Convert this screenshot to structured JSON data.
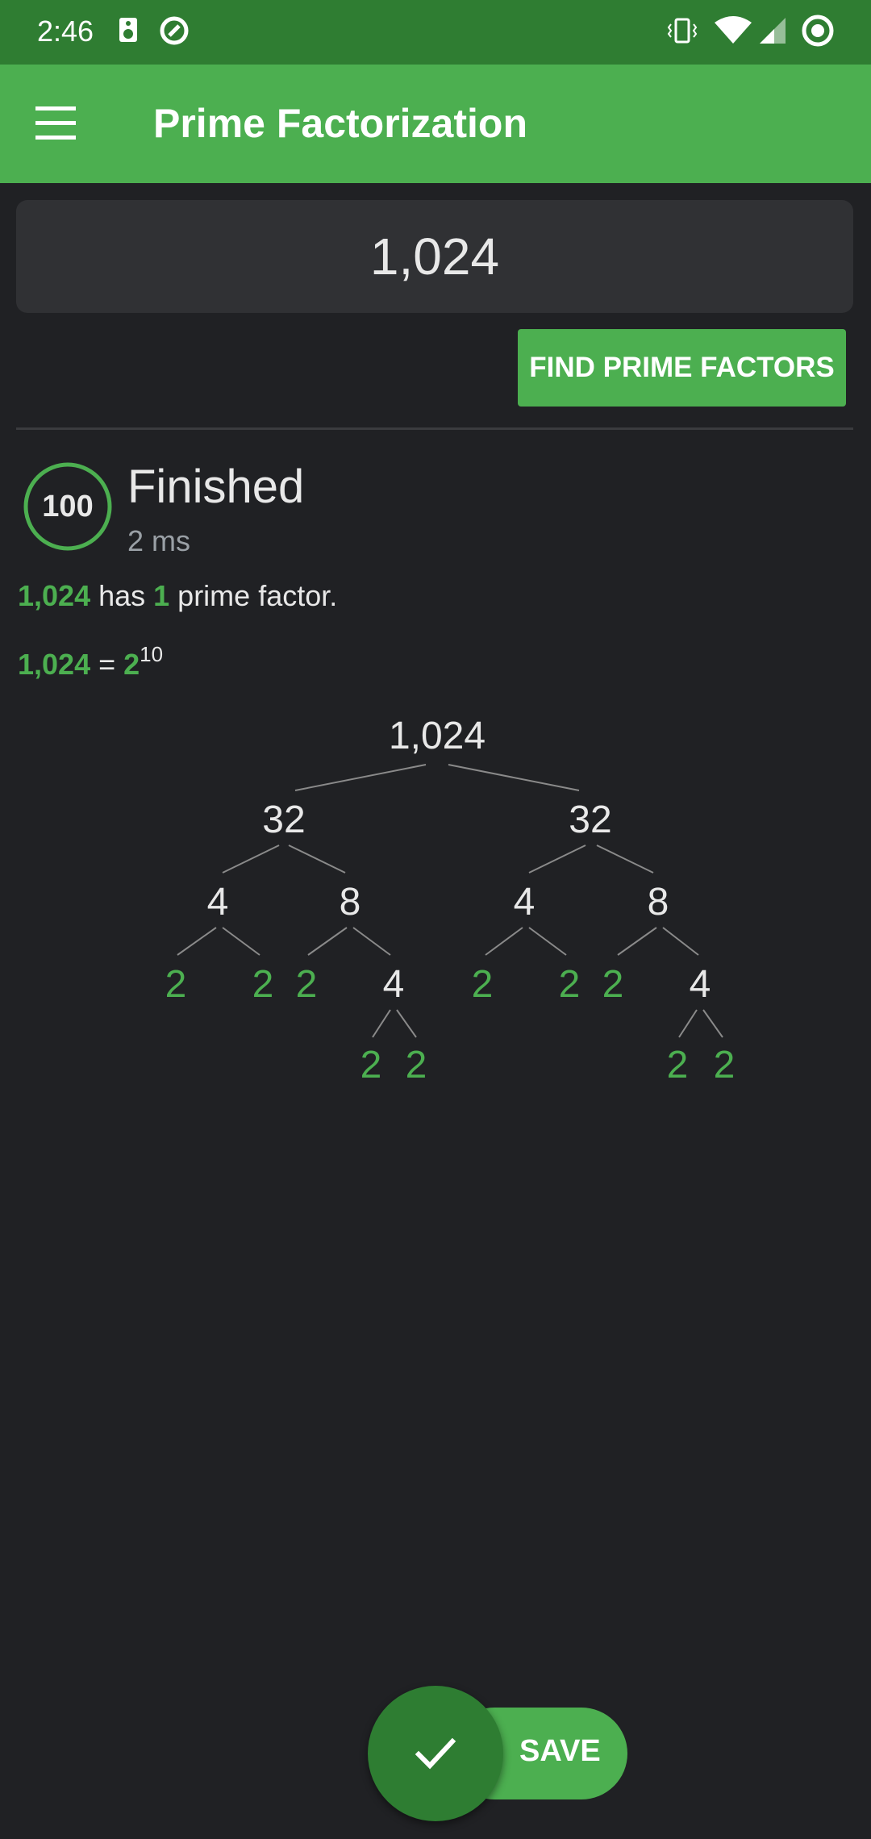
{
  "status_bar": {
    "time": "2:46",
    "icons": [
      "speaker-icon",
      "sync-icon",
      "vibrate-icon",
      "wifi-icon",
      "signal-icon",
      "record-icon"
    ]
  },
  "app_bar": {
    "title": "Prime Factorization",
    "menu_icon": "hamburger-menu-icon"
  },
  "input": {
    "value": "1,024"
  },
  "find_button": {
    "label": "FIND PRIME FACTORS"
  },
  "result": {
    "progress": "100",
    "status": "Finished",
    "elapsed": "2 ms",
    "summary": {
      "number": "1,024",
      "text1": " has ",
      "count": "1",
      "text2": " prime factor."
    },
    "equation": {
      "number": "1,024",
      "equals": " = ",
      "base": "2",
      "exponent": "10"
    }
  },
  "tree": {
    "root": "1,024",
    "nodes": [
      {
        "id": "root",
        "value": "1,024",
        "prime": false
      },
      {
        "id": "n32a",
        "value": "32",
        "prime": false
      },
      {
        "id": "n32b",
        "value": "32",
        "prime": false
      },
      {
        "id": "n4a",
        "value": "4",
        "prime": false
      },
      {
        "id": "n8a",
        "value": "8",
        "prime": false
      },
      {
        "id": "n4b",
        "value": "4",
        "prime": false
      },
      {
        "id": "n8b",
        "value": "8",
        "prime": false
      },
      {
        "id": "p1",
        "value": "2",
        "prime": true
      },
      {
        "id": "p2",
        "value": "2",
        "prime": true
      },
      {
        "id": "p3",
        "value": "2",
        "prime": true
      },
      {
        "id": "n4c",
        "value": "4",
        "prime": false
      },
      {
        "id": "p4",
        "value": "2",
        "prime": true
      },
      {
        "id": "p5",
        "value": "2",
        "prime": true
      },
      {
        "id": "p6",
        "value": "2",
        "prime": true
      },
      {
        "id": "n4d",
        "value": "4",
        "prime": false
      },
      {
        "id": "p7",
        "value": "2",
        "prime": true
      },
      {
        "id": "p8",
        "value": "2",
        "prime": true
      },
      {
        "id": "p9",
        "value": "2",
        "prime": true
      },
      {
        "id": "p10",
        "value": "2",
        "prime": true
      }
    ]
  },
  "fab": {
    "save_label": "SAVE",
    "check_icon": "check-icon"
  },
  "colors": {
    "accent": "#4caf50",
    "accent_dark": "#2e7d32",
    "background": "#202124"
  }
}
